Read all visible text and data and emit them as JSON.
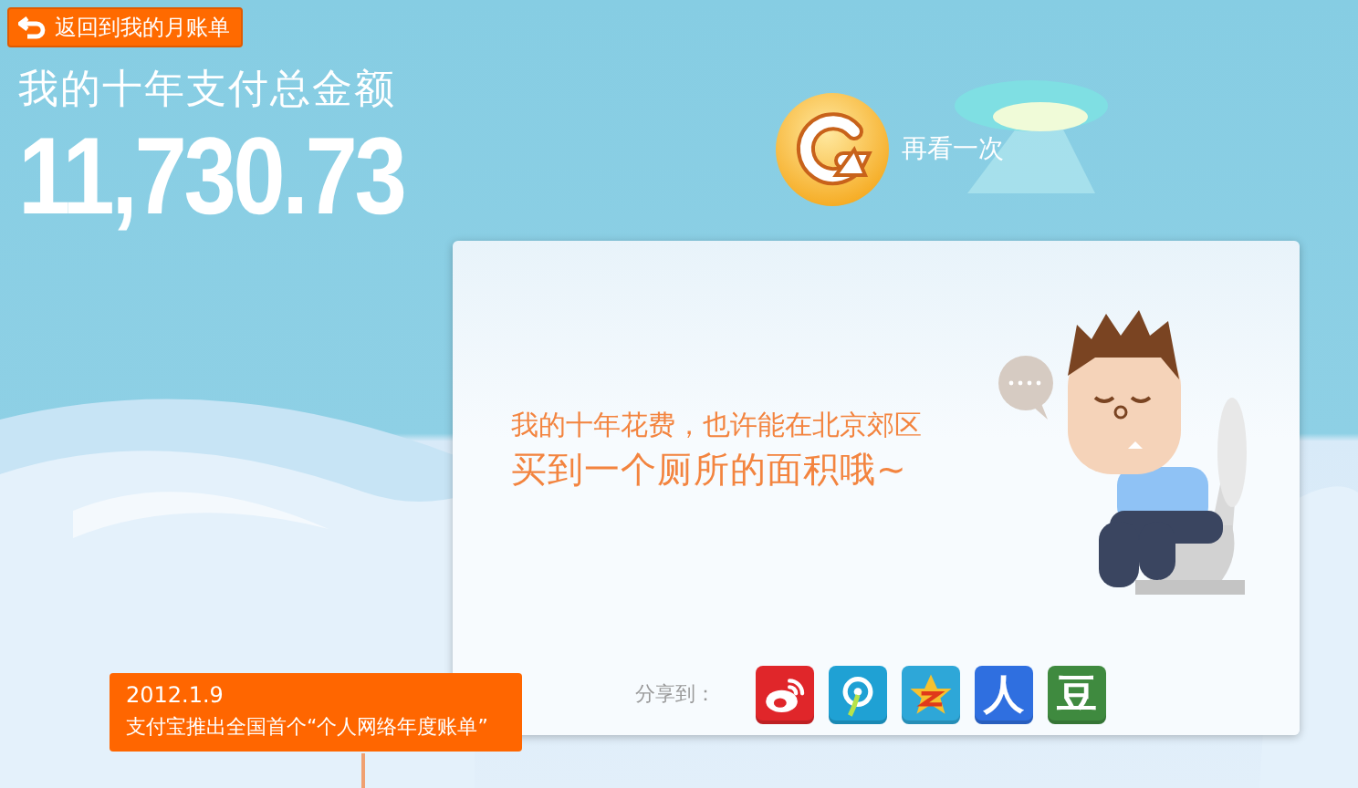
{
  "back_button": {
    "label": "返回到我的月账单"
  },
  "total": {
    "title": "我的十年支付总金额",
    "amount": "11,730.73"
  },
  "replay_button": {
    "label": "再看一次"
  },
  "message": {
    "line_1": "我的十年花费，也许能在北京郊区",
    "line_2": "买到一个厕所的面积哦~"
  },
  "share": {
    "label": "分享到：",
    "services": [
      {
        "kind": "weibo"
      },
      {
        "kind": "circle"
      },
      {
        "kind": "qzone"
      },
      {
        "kind": "renren",
        "glyph": "人"
      },
      {
        "kind": "douban",
        "glyph": "豆"
      }
    ]
  },
  "timeline": {
    "date": "2012.1.9",
    "event": "支付宝推出全国首个“个人网络年度账单”"
  }
}
